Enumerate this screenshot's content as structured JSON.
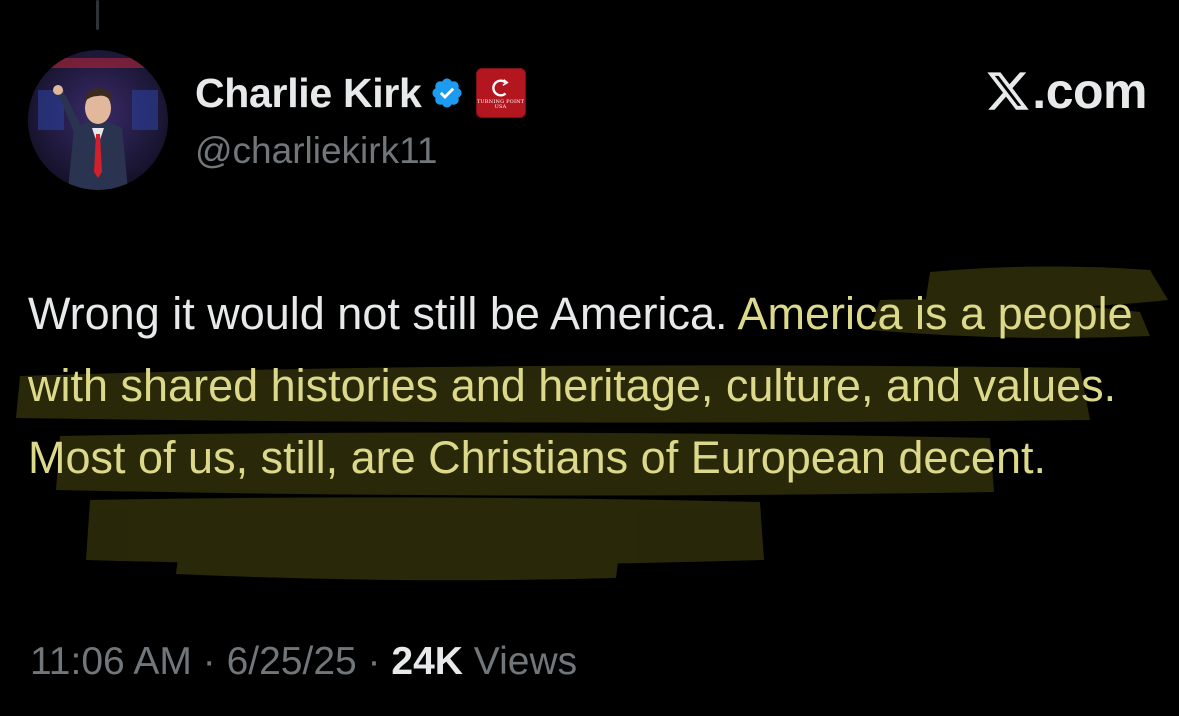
{
  "author": {
    "display_name": "Charlie Kirk",
    "handle": "@charliekirk11",
    "verified_icon": "verified-badge-icon",
    "affiliate": {
      "icon": "turning-point-usa-logo",
      "text": "TURNING POINT USA"
    }
  },
  "brand": {
    "logo": "x-logo-icon",
    "text": ".com"
  },
  "tweet": {
    "segments": [
      {
        "text": "Wrong it would not still be America. ",
        "highlighted": false
      },
      {
        "text": "America is a people with shared histories and heritage, culture, and values. Most of us, still, are Christians of European decent.",
        "highlighted": true
      }
    ]
  },
  "meta": {
    "time": "11:06 AM",
    "sep1": "·",
    "date": "6/25/25",
    "sep2": "·",
    "views_count": "24K",
    "views_label": "Views"
  },
  "colors": {
    "background": "#000000",
    "text": "#e7e9ea",
    "muted": "#71767b",
    "highlight": "#f2ea38",
    "verified": "#1d9bf0",
    "affiliate": "#b3161f"
  }
}
